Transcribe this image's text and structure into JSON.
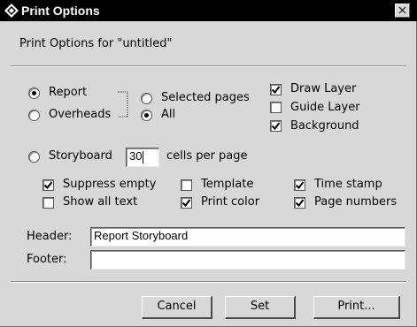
{
  "window": {
    "title": "Print Options",
    "title_icon": "app-diamond-icon",
    "close_icon": "close-icon"
  },
  "subtitle": "Print Options for \"untitled\"",
  "mode": {
    "report": {
      "label": "Report",
      "selected": true
    },
    "overheads": {
      "label": "Overheads",
      "selected": false
    },
    "storyboard": {
      "label": "Storyboard",
      "selected": false
    }
  },
  "pages": {
    "selected_pages": {
      "label": "Selected pages",
      "selected": false
    },
    "all": {
      "label": "All",
      "selected": true
    }
  },
  "layers": {
    "draw_layer": {
      "label": "Draw Layer",
      "checked": true
    },
    "guide_layer": {
      "label": "Guide Layer",
      "checked": false
    },
    "background": {
      "label": "Background",
      "checked": true
    }
  },
  "storyboard": {
    "cells_value": "30",
    "cells_label": "cells per page"
  },
  "options": {
    "suppress_empty": {
      "label": "Suppress empty",
      "checked": true
    },
    "show_all_text": {
      "label": "Show all text",
      "checked": false
    },
    "template": {
      "label": "Template",
      "checked": false
    },
    "print_color": {
      "label": "Print color",
      "checked": true
    },
    "time_stamp": {
      "label": "Time stamp",
      "checked": true
    },
    "page_numbers": {
      "label": "Page numbers",
      "checked": true
    }
  },
  "header": {
    "label": "Header:",
    "value": "Report Storyboard"
  },
  "footer": {
    "label": "Footer:",
    "value": ""
  },
  "buttons": {
    "cancel": "Cancel",
    "set": "Set",
    "print": "Print..."
  },
  "colors": {
    "titlebar": "#000000",
    "dialog_bg": "#d8d8d8"
  }
}
